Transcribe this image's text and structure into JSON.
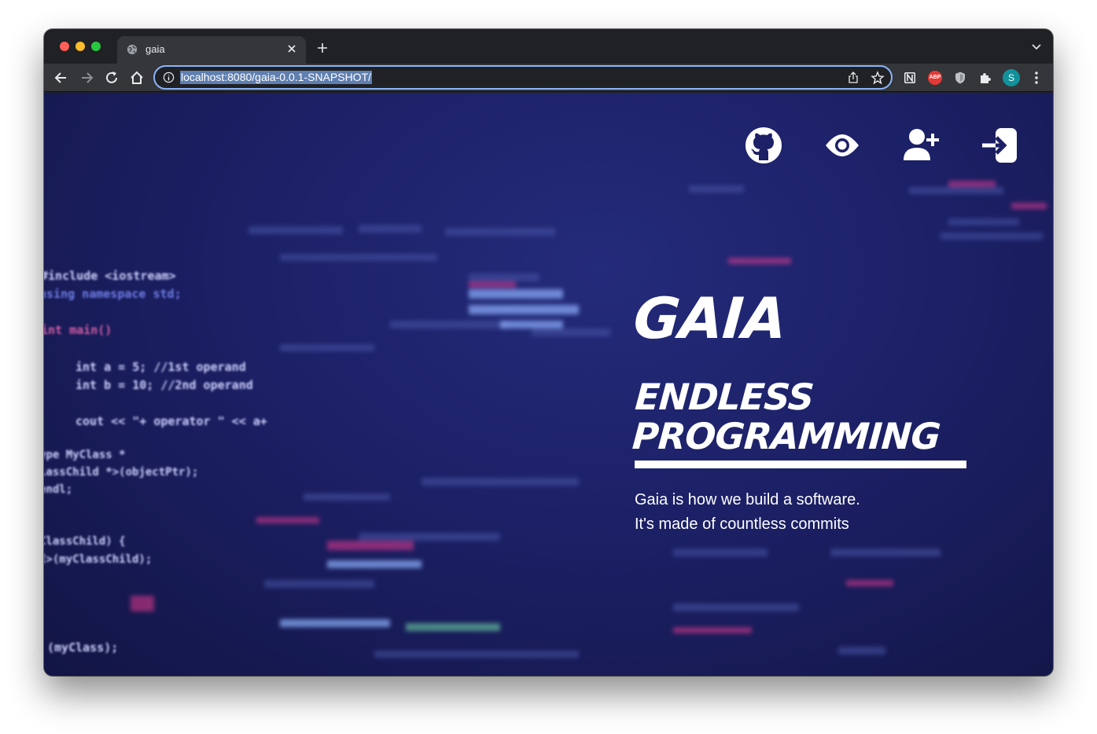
{
  "browser": {
    "tab": {
      "title": "gaia",
      "favicon": "globe-icon"
    },
    "address_bar": {
      "url": "localhost:8080/gaia-0.0.1-SNAPSHOT/"
    },
    "profile": {
      "initial": "S",
      "color": "#12919b"
    },
    "extensions": {
      "adblock_label": "ABP"
    }
  },
  "page": {
    "nav_icons": [
      "github-icon",
      "eye-icon",
      "user-plus-icon",
      "sign-in-icon"
    ],
    "hero": {
      "title": "GAIA",
      "tagline_line1": "ENDLESS",
      "tagline_line2": "PROGRAMMING",
      "description_line1": "Gaia is how we build a software.",
      "description_line2": "It's made of countless commits"
    },
    "background_code": [
      "#include <iostream>",
      "using namespace std;",
      "int main()",
      "int a = 5; //1st operand",
      "int b = 10; //2nd operand",
      "cout << \"+ operator \" << a+",
      "ype MyClass *",
      "lassChild *>(objectPtr);",
      "endl;",
      "ClassChild) {",
      "E>(myClassChild);",
      "(myClass);"
    ],
    "colors": {
      "background": "#1c2066",
      "text": "#ffffff",
      "accent_code": "#e83a8f"
    }
  }
}
